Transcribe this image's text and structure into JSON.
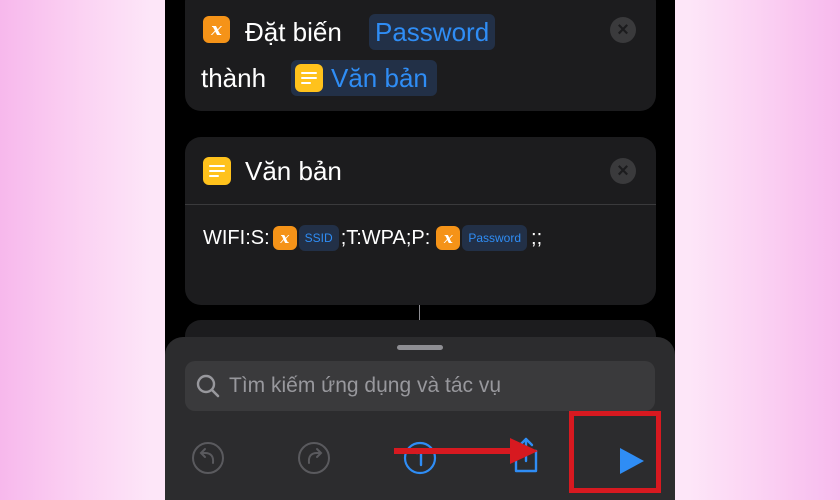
{
  "set_variable_action": {
    "verb": "Đặt biến",
    "variable_name": "Password",
    "connector": "thành",
    "value": "Văn bản",
    "variable_icon": "x-variable-icon",
    "value_icon": "text-icon"
  },
  "text_action": {
    "title": "Văn bản",
    "content_prefix": "WIFI:S:",
    "token1": "SSID",
    "content_middle": ";T:WPA;P:",
    "token2": "Password",
    "content_suffix": ";;"
  },
  "bottom_sheet": {
    "search_placeholder": "Tìm kiếm ứng dụng và tác vụ",
    "toolbar_icons": [
      "undo-icon",
      "redo-icon",
      "info-icon",
      "share-icon",
      "play-icon"
    ]
  },
  "colors": {
    "background_pink": "#f7b8ec",
    "card_bg": "#1c1c1e",
    "accent_blue": "#2f8df5",
    "variable_orange": "#f59318",
    "text_yellow": "#ffc21c",
    "highlight_red": "#d71920"
  }
}
